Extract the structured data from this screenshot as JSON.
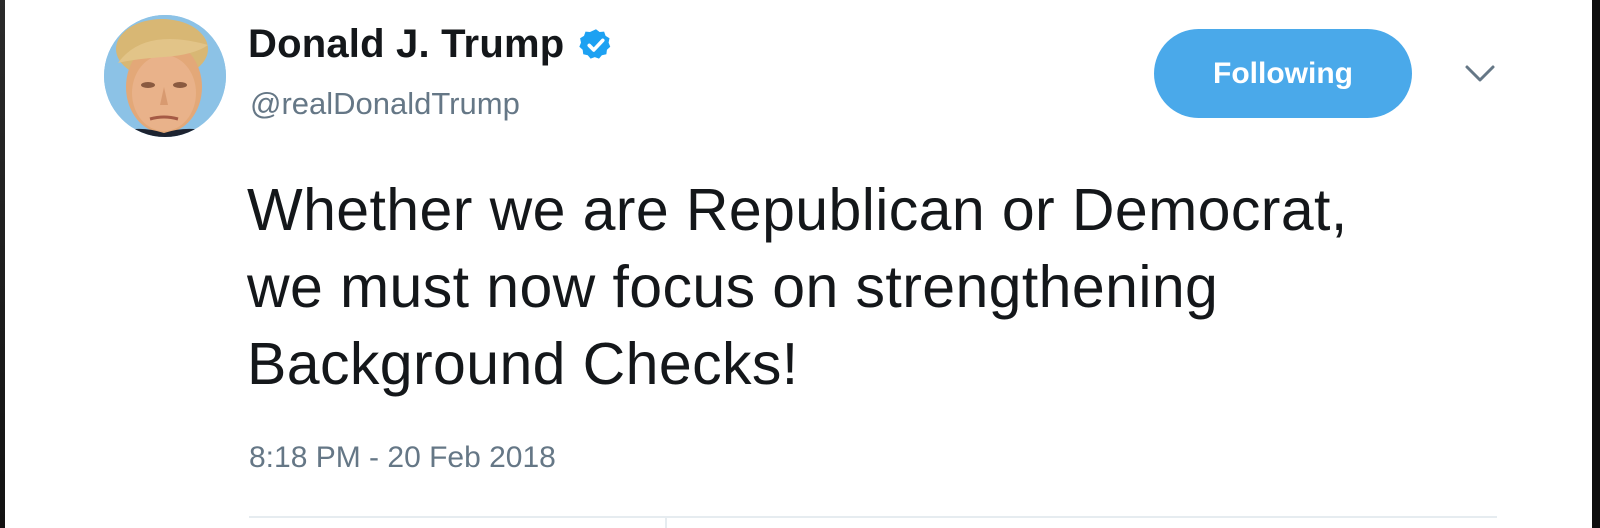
{
  "author": {
    "display_name": "Donald J. Trump",
    "handle": "@realDonaldTrump",
    "verified": true,
    "verified_icon": "verified-badge-icon",
    "avatar_icon": "profile-photo"
  },
  "actions": {
    "follow_label": "Following",
    "caret_icon": "chevron-down-icon"
  },
  "tweet": {
    "text": "Whether we are Republican or Democrat,\nwe must now focus on strengthening\nBackground Checks!",
    "timestamp": "8:18 PM - 20 Feb 2018"
  },
  "colors": {
    "accent": "#4aa9ea",
    "verified": "#1da1f2",
    "muted_text": "#657786",
    "primary_text": "#14171a"
  }
}
